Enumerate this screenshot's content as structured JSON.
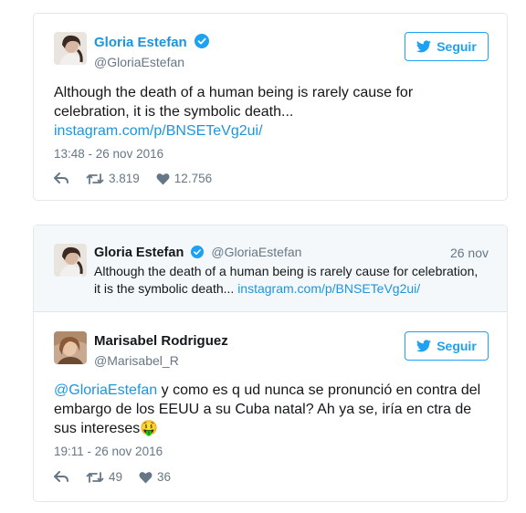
{
  "tweet": {
    "author_name": "Gloria Estefan",
    "author_handle": "@GloriaEstefan",
    "follow_label": "Seguir",
    "text_line1": "Although the death of a human being is rarely cause for",
    "text_line2": "celebration, it is the symbolic death...",
    "link": "instagram.com/p/BNSETeVg2ui/",
    "timestamp": "13:48 - 26 nov 2016",
    "retweets": "3.819",
    "likes": "12.756"
  },
  "reply": {
    "quoted": {
      "author_name": "Gloria Estefan",
      "author_handle": "@GloriaEstefan",
      "date": "26 nov",
      "text_line1": "Although the death of a human being is rarely cause for celebration,",
      "text_line2": "it is the symbolic death...",
      "link": "instagram.com/p/BNSETeVg2ui/"
    },
    "author_name": "Marisabel Rodriguez",
    "author_handle": "@Marisabel_R",
    "follow_label": "Seguir",
    "mention": "@GloriaEstefan",
    "text_line1_rest": " y como es q ud nunca se pronunció en contra del",
    "text_line2": "embargo de los EEUU a su Cuba natal? Ah ya se, iría en ctra de",
    "text_line3": "sus intereses",
    "emoji": "🤑",
    "timestamp": "19:11 - 26 nov 2016",
    "retweets": "49",
    "likes": "36"
  },
  "colors": {
    "brand_blue": "#1da1f2",
    "link_blue": "#1b95e0",
    "muted": "#657786",
    "border": "#e1e8ed"
  }
}
